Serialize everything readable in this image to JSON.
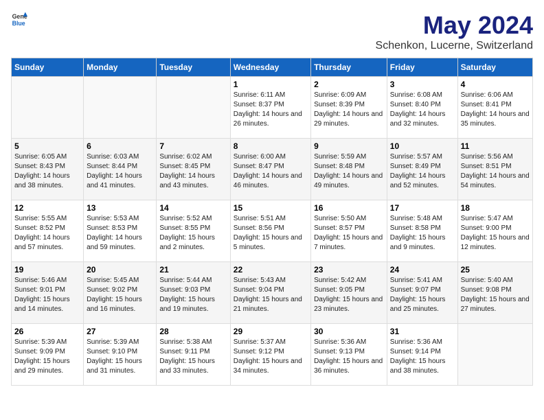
{
  "logo": {
    "text_general": "General",
    "text_blue": "Blue",
    "arrow_color": "#1565c0"
  },
  "title": "May 2024",
  "subtitle": "Schenkon, Lucerne, Switzerland",
  "days_of_week": [
    "Sunday",
    "Monday",
    "Tuesday",
    "Wednesday",
    "Thursday",
    "Friday",
    "Saturday"
  ],
  "weeks": [
    [
      {
        "day": "",
        "info": ""
      },
      {
        "day": "",
        "info": ""
      },
      {
        "day": "",
        "info": ""
      },
      {
        "day": "1",
        "info": "Sunrise: 6:11 AM\nSunset: 8:37 PM\nDaylight: 14 hours and 26 minutes."
      },
      {
        "day": "2",
        "info": "Sunrise: 6:09 AM\nSunset: 8:39 PM\nDaylight: 14 hours and 29 minutes."
      },
      {
        "day": "3",
        "info": "Sunrise: 6:08 AM\nSunset: 8:40 PM\nDaylight: 14 hours and 32 minutes."
      },
      {
        "day": "4",
        "info": "Sunrise: 6:06 AM\nSunset: 8:41 PM\nDaylight: 14 hours and 35 minutes."
      }
    ],
    [
      {
        "day": "5",
        "info": "Sunrise: 6:05 AM\nSunset: 8:43 PM\nDaylight: 14 hours and 38 minutes."
      },
      {
        "day": "6",
        "info": "Sunrise: 6:03 AM\nSunset: 8:44 PM\nDaylight: 14 hours and 41 minutes."
      },
      {
        "day": "7",
        "info": "Sunrise: 6:02 AM\nSunset: 8:45 PM\nDaylight: 14 hours and 43 minutes."
      },
      {
        "day": "8",
        "info": "Sunrise: 6:00 AM\nSunset: 8:47 PM\nDaylight: 14 hours and 46 minutes."
      },
      {
        "day": "9",
        "info": "Sunrise: 5:59 AM\nSunset: 8:48 PM\nDaylight: 14 hours and 49 minutes."
      },
      {
        "day": "10",
        "info": "Sunrise: 5:57 AM\nSunset: 8:49 PM\nDaylight: 14 hours and 52 minutes."
      },
      {
        "day": "11",
        "info": "Sunrise: 5:56 AM\nSunset: 8:51 PM\nDaylight: 14 hours and 54 minutes."
      }
    ],
    [
      {
        "day": "12",
        "info": "Sunrise: 5:55 AM\nSunset: 8:52 PM\nDaylight: 14 hours and 57 minutes."
      },
      {
        "day": "13",
        "info": "Sunrise: 5:53 AM\nSunset: 8:53 PM\nDaylight: 14 hours and 59 minutes."
      },
      {
        "day": "14",
        "info": "Sunrise: 5:52 AM\nSunset: 8:55 PM\nDaylight: 15 hours and 2 minutes."
      },
      {
        "day": "15",
        "info": "Sunrise: 5:51 AM\nSunset: 8:56 PM\nDaylight: 15 hours and 5 minutes."
      },
      {
        "day": "16",
        "info": "Sunrise: 5:50 AM\nSunset: 8:57 PM\nDaylight: 15 hours and 7 minutes."
      },
      {
        "day": "17",
        "info": "Sunrise: 5:48 AM\nSunset: 8:58 PM\nDaylight: 15 hours and 9 minutes."
      },
      {
        "day": "18",
        "info": "Sunrise: 5:47 AM\nSunset: 9:00 PM\nDaylight: 15 hours and 12 minutes."
      }
    ],
    [
      {
        "day": "19",
        "info": "Sunrise: 5:46 AM\nSunset: 9:01 PM\nDaylight: 15 hours and 14 minutes."
      },
      {
        "day": "20",
        "info": "Sunrise: 5:45 AM\nSunset: 9:02 PM\nDaylight: 15 hours and 16 minutes."
      },
      {
        "day": "21",
        "info": "Sunrise: 5:44 AM\nSunset: 9:03 PM\nDaylight: 15 hours and 19 minutes."
      },
      {
        "day": "22",
        "info": "Sunrise: 5:43 AM\nSunset: 9:04 PM\nDaylight: 15 hours and 21 minutes."
      },
      {
        "day": "23",
        "info": "Sunrise: 5:42 AM\nSunset: 9:05 PM\nDaylight: 15 hours and 23 minutes."
      },
      {
        "day": "24",
        "info": "Sunrise: 5:41 AM\nSunset: 9:07 PM\nDaylight: 15 hours and 25 minutes."
      },
      {
        "day": "25",
        "info": "Sunrise: 5:40 AM\nSunset: 9:08 PM\nDaylight: 15 hours and 27 minutes."
      }
    ],
    [
      {
        "day": "26",
        "info": "Sunrise: 5:39 AM\nSunset: 9:09 PM\nDaylight: 15 hours and 29 minutes."
      },
      {
        "day": "27",
        "info": "Sunrise: 5:39 AM\nSunset: 9:10 PM\nDaylight: 15 hours and 31 minutes."
      },
      {
        "day": "28",
        "info": "Sunrise: 5:38 AM\nSunset: 9:11 PM\nDaylight: 15 hours and 33 minutes."
      },
      {
        "day": "29",
        "info": "Sunrise: 5:37 AM\nSunset: 9:12 PM\nDaylight: 15 hours and 34 minutes."
      },
      {
        "day": "30",
        "info": "Sunrise: 5:36 AM\nSunset: 9:13 PM\nDaylight: 15 hours and 36 minutes."
      },
      {
        "day": "31",
        "info": "Sunrise: 5:36 AM\nSunset: 9:14 PM\nDaylight: 15 hours and 38 minutes."
      },
      {
        "day": "",
        "info": ""
      }
    ]
  ]
}
